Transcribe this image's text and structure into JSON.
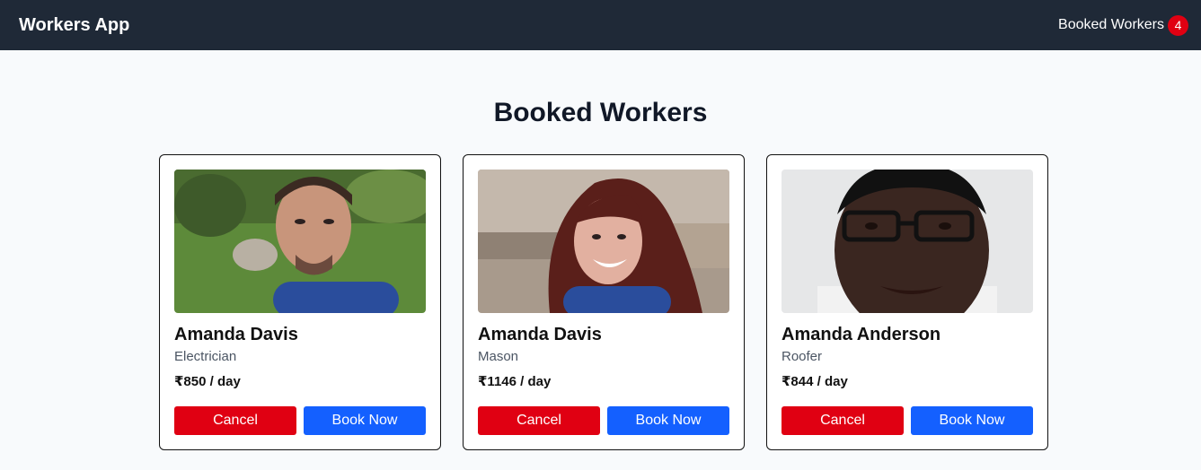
{
  "navbar": {
    "brand": "Workers App",
    "booked_link": "Booked Workers",
    "booked_count": "4"
  },
  "page": {
    "title": "Booked Workers"
  },
  "workers": [
    {
      "name": "Amanda Davis",
      "role": "Electrician",
      "price": "₹850 / day",
      "cancel_label": "Cancel",
      "book_label": "Book Now"
    },
    {
      "name": "Amanda Davis",
      "role": "Mason",
      "price": "₹1146 / day",
      "cancel_label": "Cancel",
      "book_label": "Book Now"
    },
    {
      "name": "Amanda Anderson",
      "role": "Roofer",
      "price": "₹844 / day",
      "cancel_label": "Cancel",
      "book_label": "Book Now"
    }
  ],
  "colors": {
    "navbar_bg": "#1f2937",
    "cancel": "#e00012",
    "book": "#1460ff",
    "badge": "#e00012"
  }
}
